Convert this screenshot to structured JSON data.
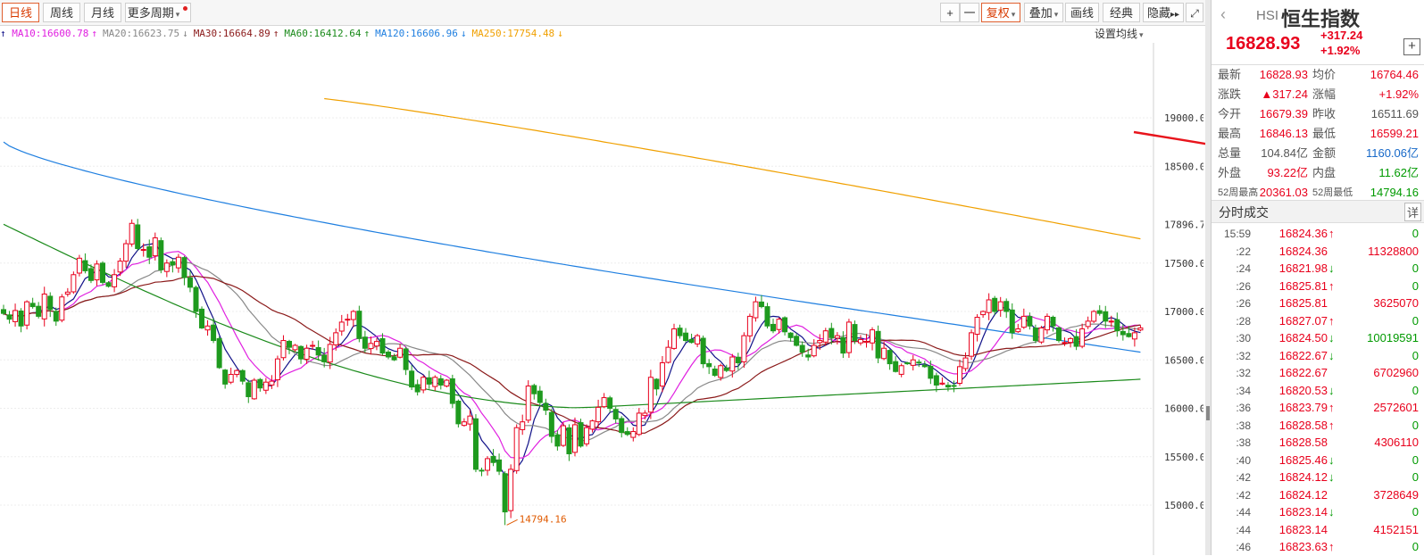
{
  "toolbar": {
    "tabs": [
      {
        "label": "日线",
        "active": true
      },
      {
        "label": "周线",
        "active": false
      },
      {
        "label": "月线",
        "active": false
      }
    ],
    "more_period": "更多周期",
    "right_buttons": [
      {
        "label": "+"
      },
      {
        "label": "一"
      },
      {
        "label": "复权",
        "active": true
      },
      {
        "label": "叠加"
      },
      {
        "label": "画线"
      },
      {
        "label": "经典"
      },
      {
        "label": "隐藏"
      }
    ],
    "hide_arrows": "▸▸",
    "fullscreen_icon": "expand-icon"
  },
  "ma_legend": {
    "items": [
      {
        "text": "MA10:16600.78",
        "arrow": "↑",
        "color": "#e020e0"
      },
      {
        "text": "MA20:16623.75",
        "arrow": "↓",
        "color": "#888888"
      },
      {
        "text": "MA30:16664.89",
        "arrow": "↑",
        "color": "#8b1a1a"
      },
      {
        "text": "MA60:16412.64",
        "arrow": "↑",
        "color": "#1a8a1a"
      },
      {
        "text": "MA120:16606.96",
        "arrow": "↓",
        "color": "#1f7fe0"
      },
      {
        "text": "MA250:17754.48",
        "arrow": "↓",
        "color": "#f0a000"
      }
    ],
    "first_arrow": "↑",
    "setting_label": "设置均线"
  },
  "chart_data": {
    "type": "candlestick",
    "ylim": [
      14800,
      19500
    ],
    "y_ticks": [
      "19000.0",
      "18500.0",
      "17896.7",
      "17500.0",
      "17000.0",
      "16500.0",
      "16000.0",
      "15500.0",
      "15000.0"
    ],
    "y_tick_values": [
      19000,
      18500,
      17896.7,
      17500,
      17000,
      16500,
      16000,
      15500,
      15000
    ],
    "low_annotation": "14794.16",
    "low_index": 86,
    "colors": {
      "up": "#e8001c",
      "down": "#1e9a1e",
      "ma5": "#101088",
      "ma10": "#e020e0",
      "ma20": "#888888",
      "ma30": "#8b1a1a",
      "ma60": "#1a8a1a",
      "ma120": "#1f7fe0",
      "ma250": "#f0a000"
    },
    "close": [
      16980,
      16920,
      17010,
      16850,
      17100,
      17050,
      16950,
      17180,
      17020,
      16900,
      17150,
      17200,
      17380,
      17550,
      17420,
      17320,
      17490,
      17300,
      17260,
      17380,
      17520,
      17700,
      17910,
      17650,
      17640,
      17560,
      17760,
      17430,
      17500,
      17480,
      17560,
      17350,
      17250,
      17000,
      16830,
      16850,
      16700,
      16420,
      16250,
      16350,
      16390,
      16280,
      16120,
      16290,
      16210,
      16270,
      16280,
      16510,
      16700,
      16630,
      16650,
      16510,
      16620,
      16650,
      16550,
      16480,
      16660,
      16780,
      16890,
      16920,
      17000,
      16720,
      16620,
      16670,
      16690,
      16570,
      16530,
      16500,
      16620,
      16400,
      16220,
      16170,
      16320,
      16250,
      16320,
      16240,
      16290,
      16050,
      15840,
      15860,
      15920,
      15370,
      15360,
      15480,
      15440,
      15350,
      14930,
      15370,
      15800,
      15860,
      16230,
      16150,
      16060,
      15980,
      15710,
      15610,
      15820,
      15530,
      15830,
      15610,
      15800,
      15870,
      16010,
      16110,
      16000,
      15890,
      15750,
      15730,
      15760,
      15950,
      15950,
      16320,
      16200,
      16470,
      16630,
      16820,
      16750,
      16700,
      16680,
      16750,
      16460,
      16430,
      16340,
      16440,
      16390,
      16530,
      16470,
      16750,
      16950,
      17100,
      17050,
      16850,
      16800,
      16920,
      16790,
      16730,
      16650,
      16580,
      16530,
      16650,
      16700,
      16800,
      16730,
      16750,
      16570,
      16890,
      16700,
      16710,
      16690,
      16810,
      16520,
      16620,
      16460,
      16380,
      16440,
      16460,
      16500,
      16470,
      16430,
      16310,
      16240,
      16260,
      16220,
      16230,
      16430,
      16520,
      16780,
      16940,
      17000,
      17120,
      17000,
      17100,
      17000,
      16780,
      16820,
      16950,
      16850,
      16700,
      16830,
      16950,
      16850,
      16700,
      16680,
      16720,
      16640,
      16820,
      16900,
      17000,
      16980,
      16900,
      16900,
      16800,
      16760,
      16740,
      16780,
      16830
    ],
    "ma_last": {
      "MA10": 16600.78,
      "MA20": 16623.75,
      "MA30": 16664.89,
      "MA60": 16412.64,
      "MA120": 16606.96,
      "MA250": 17754.48
    }
  },
  "quote": {
    "code": "HSI",
    "name": "恒生指数",
    "price": "16828.93",
    "change": "+317.24",
    "change_pct": "+1.92%",
    "add_icon": "plus-box-icon",
    "back_icon": "chevron-left-icon",
    "rows": [
      {
        "l1": "最新",
        "v1": "16828.93",
        "c1": "red",
        "l2": "均价",
        "v2": "16764.46",
        "c2": "red"
      },
      {
        "l1": "涨跌",
        "v1": "▲317.24",
        "c1": "red",
        "l2": "涨幅",
        "v2": "+1.92%",
        "c2": "red"
      },
      {
        "l1": "今开",
        "v1": "16679.39",
        "c1": "red",
        "l2": "昨收",
        "v2": "16511.69",
        "c2": "gray"
      },
      {
        "l1": "最高",
        "v1": "16846.13",
        "c1": "red",
        "l2": "最低",
        "v2": "16599.21",
        "c2": "red"
      },
      {
        "l1": "总量",
        "v1": "104.84亿",
        "c1": "gray",
        "l2": "金额",
        "v2": "1160.06亿",
        "c2": "blue"
      },
      {
        "l1": "外盘",
        "v1": "93.22亿",
        "c1": "red",
        "l2": "内盘",
        "v2": "11.62亿",
        "c2": "green"
      },
      {
        "l1": "52周最高",
        "v1": "20361.03",
        "c1": "red",
        "l2": "52周最低",
        "v2": "14794.16",
        "c2": "green"
      }
    ]
  },
  "ticks_panel": {
    "title": "分时成交",
    "detail_label": "详",
    "rows": [
      {
        "time": "15:59",
        "price": "16824.36",
        "dir": "↑",
        "vol": "0",
        "vc": "green"
      },
      {
        "time": ":22",
        "price": "16824.36",
        "dir": "",
        "vol": "11328800",
        "vc": "red"
      },
      {
        "time": ":24",
        "price": "16821.98",
        "dir": "↓",
        "vol": "0",
        "vc": "green"
      },
      {
        "time": ":26",
        "price": "16825.81",
        "dir": "↑",
        "vol": "0",
        "vc": "green"
      },
      {
        "time": ":26",
        "price": "16825.81",
        "dir": "",
        "vol": "3625070",
        "vc": "red"
      },
      {
        "time": ":28",
        "price": "16827.07",
        "dir": "↑",
        "vol": "0",
        "vc": "green"
      },
      {
        "time": ":30",
        "price": "16824.50",
        "dir": "↓",
        "vol": "10019591",
        "vc": "green"
      },
      {
        "time": ":32",
        "price": "16822.67",
        "dir": "↓",
        "vol": "0",
        "vc": "green"
      },
      {
        "time": ":32",
        "price": "16822.67",
        "dir": "",
        "vol": "6702960",
        "vc": "red"
      },
      {
        "time": ":34",
        "price": "16820.53",
        "dir": "↓",
        "vol": "0",
        "vc": "green"
      },
      {
        "time": ":36",
        "price": "16823.79",
        "dir": "↑",
        "vol": "2572601",
        "vc": "red"
      },
      {
        "time": ":38",
        "price": "16828.58",
        "dir": "↑",
        "vol": "0",
        "vc": "green"
      },
      {
        "time": ":38",
        "price": "16828.58",
        "dir": "",
        "vol": "4306110",
        "vc": "red"
      },
      {
        "time": ":40",
        "price": "16825.46",
        "dir": "↓",
        "vol": "0",
        "vc": "green"
      },
      {
        "time": ":42",
        "price": "16824.12",
        "dir": "↓",
        "vol": "0",
        "vc": "green"
      },
      {
        "time": ":42",
        "price": "16824.12",
        "dir": "",
        "vol": "3728649",
        "vc": "red"
      },
      {
        "time": ":44",
        "price": "16823.14",
        "dir": "↓",
        "vol": "0",
        "vc": "green"
      },
      {
        "time": ":44",
        "price": "16823.14",
        "dir": "",
        "vol": "4152151",
        "vc": "red"
      },
      {
        "time": ":46",
        "price": "16823.63",
        "dir": "↑",
        "vol": "0",
        "vc": "green"
      }
    ]
  }
}
